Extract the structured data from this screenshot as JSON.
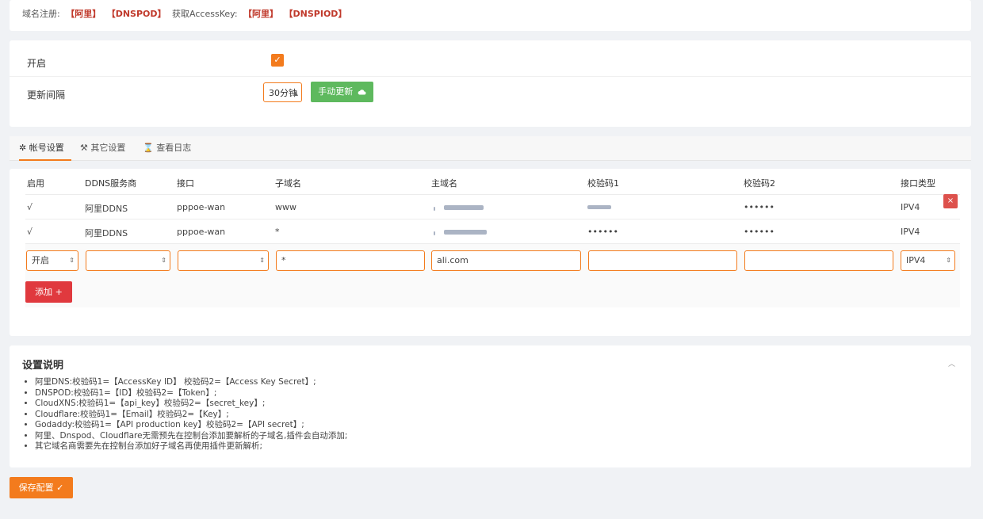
{
  "top": {
    "label": "域名注册:",
    "links": [
      "【阿里】",
      "【DNSPOD】"
    ],
    "accesskey_label": "获取AccessKey:",
    "ak_links": [
      "【阿里】",
      "【DNSPIOD】"
    ]
  },
  "settings": {
    "enable_label": "开启",
    "interval_label": "更新间隔",
    "interval_value": "30分钟",
    "manual_update_label": "手动更新"
  },
  "tabs": [
    "帐号设置",
    "其它设置",
    "查看日志"
  ],
  "table": {
    "headers": [
      "启用",
      "DDNS服务商",
      "接口",
      "子域名",
      "主域名",
      "校验码1",
      "校验码2",
      "接口类型"
    ],
    "rows": [
      {
        "enabled": "√",
        "provider": "阿里DDNS",
        "iface": "pppoe-wan",
        "sub": "www",
        "key1": "",
        "key2": "••••••",
        "type": "IPV4"
      },
      {
        "enabled": "√",
        "provider": "阿里DDNS",
        "iface": "pppoe-wan",
        "sub": "*",
        "key1": "••••••",
        "key2": "••••••",
        "type": "IPV4"
      }
    ],
    "new_row": {
      "enabled": "开启",
      "sub": "*",
      "main": "ali.com",
      "type": "IPV4"
    },
    "add_label": "添加 +",
    "delete_label": "×"
  },
  "notes": {
    "title": "设置说明",
    "items": [
      "阿里DNS:校验码1=【AccessKey ID】 校验码2=【Access Key Secret】;",
      "DNSPOD:校验码1=【ID】校验码2=【Token】;",
      "CloudXNS:校验码1=【api_key】校验码2=【secret_key】;",
      "Cloudflare:校验码1=【Email】校验码2=【Key】;",
      "Godaddy:校验码1=【API production key】校验码2=【API secret】;",
      "阿里、Dnspod、Cloudflare无需预先在控制台添加要解析的子域名,插件会自动添加;",
      "其它域名商需要先在控制台添加好子域名再使用插件更新解析;"
    ]
  },
  "save_label": "保存配置 ✓",
  "colors": {
    "accent": "#f37b1d",
    "success": "#5eb95e",
    "danger": "#e0393e"
  }
}
